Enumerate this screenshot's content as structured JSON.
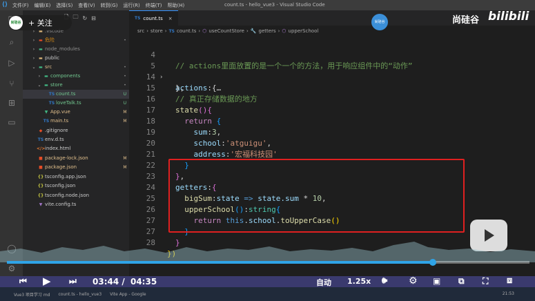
{
  "titlebar": {
    "menu": [
      "文件(F)",
      "编辑(E)",
      "选择(S)",
      "查看(V)",
      "转到(G)",
      "运行(R)",
      "终端(T)",
      "帮助(H)"
    ],
    "window_title": "count.ts - hello_vue3 - Visual Studio Code"
  },
  "follow": {
    "label": "+ 关注",
    "logo_text": "尚硅谷"
  },
  "sidebar": {
    "items": [
      {
        "name": ".vscode",
        "kind": "folder",
        "status": ""
      },
      {
        "name": "危险",
        "kind": "folder",
        "status": "•"
      },
      {
        "name": "node_modules",
        "kind": "folder",
        "status": ""
      },
      {
        "name": "public",
        "kind": "folder",
        "status": ""
      },
      {
        "name": "src",
        "kind": "folder",
        "status": "•"
      },
      {
        "name": "components",
        "kind": "folder",
        "status": "•"
      },
      {
        "name": "store",
        "kind": "folder",
        "status": "•"
      },
      {
        "name": "count.ts",
        "kind": "ts",
        "status": "U"
      },
      {
        "name": "loveTalk.ts",
        "kind": "ts",
        "status": "U"
      },
      {
        "name": "App.vue",
        "kind": "vue",
        "status": "M"
      },
      {
        "name": "main.ts",
        "kind": "ts",
        "status": "M"
      },
      {
        "name": ".gitignore",
        "kind": "git",
        "status": ""
      },
      {
        "name": "env.d.ts",
        "kind": "ts",
        "status": ""
      },
      {
        "name": "index.html",
        "kind": "html",
        "status": ""
      },
      {
        "name": "package-lock.json",
        "kind": "json",
        "status": "M"
      },
      {
        "name": "package.json",
        "kind": "json",
        "status": "M"
      },
      {
        "name": "tsconfig.app.json",
        "kind": "json",
        "status": ""
      },
      {
        "name": "tsconfig.json",
        "kind": "json",
        "status": ""
      },
      {
        "name": "tsconfig.node.json",
        "kind": "json",
        "status": ""
      },
      {
        "name": "vite.config.ts",
        "kind": "vite",
        "status": ""
      }
    ]
  },
  "tab": {
    "label": "count.ts",
    "badge": "TS",
    "close": "×"
  },
  "breadcrumb": {
    "parts": [
      "src",
      "store",
      "count.ts",
      "useCountStore",
      "getters",
      "upperSchool"
    ]
  },
  "editor": {
    "line_numbers": [
      "4",
      "5",
      "14",
      "15",
      "16",
      "17",
      "18",
      "19",
      "20",
      "21",
      "22",
      "23",
      "24",
      "25",
      "26",
      "27",
      "28"
    ],
    "lines": {
      "l4": "// actions里面放置的是一个一个的方法，用于响应组件中的“动作”",
      "l5_prop": "actions",
      "l5_rest": ":{…",
      "l14": "},",
      "l15": "// 真正存储数据的地方",
      "l16_fn": "state",
      "l17_kw": "return",
      "l18_prop": "sum",
      "l18_num": "3",
      "l19_prop": "school",
      "l19_str": "'atguigu'",
      "l20_prop": "address",
      "l20_str": "'宏福科技园'",
      "l22_prop": "getters",
      "l23_prop": "bigSum",
      "l23_param": "state",
      "l23_arrow": "=>",
      "l23_expr": "state.sum",
      "l23_num": "10",
      "l24_fn": "upperSchool",
      "l24_type": "string",
      "l25_kw": "return",
      "l25_this": "this",
      "l25_prop": "school",
      "l25_fn": "toUpperCase"
    }
  },
  "overlay": {
    "brand": "尚硅谷",
    "bili": "bilibili",
    "avatar_text": "尚硅谷"
  },
  "player": {
    "time_current": "03:44",
    "time_separator": "/",
    "time_total": "04:35",
    "progress_fraction": 0.815,
    "auto_label": "自动",
    "speed_label": "1.25x"
  },
  "statusbar": {
    "left": "Vue3 项目学习 md",
    "mid": "count.ts - hello_vue3",
    "right": "Vite App - Google"
  },
  "taskbar": {
    "clock": "21:53"
  },
  "colors": {
    "highlight_box": "#e02020",
    "progress": "#2fa4e7",
    "activity_badge": "#3794ff"
  }
}
